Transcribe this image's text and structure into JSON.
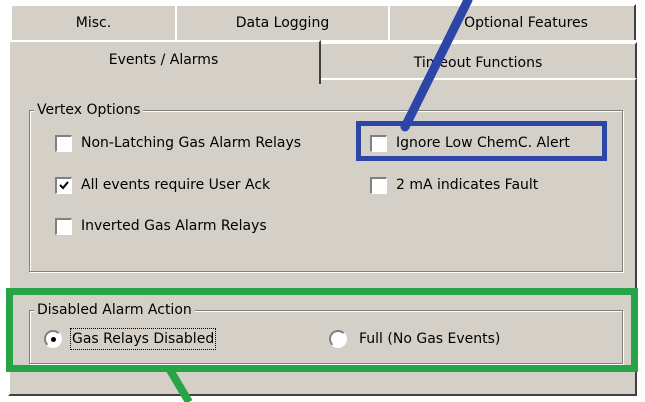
{
  "tabs": {
    "row_back": [
      {
        "label": "Misc."
      },
      {
        "label": "Data Logging"
      },
      {
        "label": "Optional Features"
      }
    ],
    "row_front": [
      {
        "label": "Events / Alarms",
        "selected": true
      },
      {
        "label": "Timeout Functions"
      }
    ]
  },
  "vertex_options": {
    "legend": "Vertex Options",
    "checkboxes": [
      {
        "label": "Non-Latching Gas Alarm Relays",
        "checked": false
      },
      {
        "label": "Ignore Low ChemC. Alert",
        "checked": false
      },
      {
        "label": "All events require User Ack",
        "checked": true
      },
      {
        "label": "2 mA indicates Fault",
        "checked": false
      },
      {
        "label": "Inverted Gas Alarm Relays",
        "checked": false
      }
    ]
  },
  "disabled_alarm_action": {
    "legend": "Disabled Alarm Action",
    "options": [
      {
        "label": "Gas Relays Disabled",
        "selected": true
      },
      {
        "label": "Full (No Gas Events)",
        "selected": false
      }
    ]
  },
  "annotation": {
    "blue": "#2e45a8",
    "green": "#28a448"
  }
}
